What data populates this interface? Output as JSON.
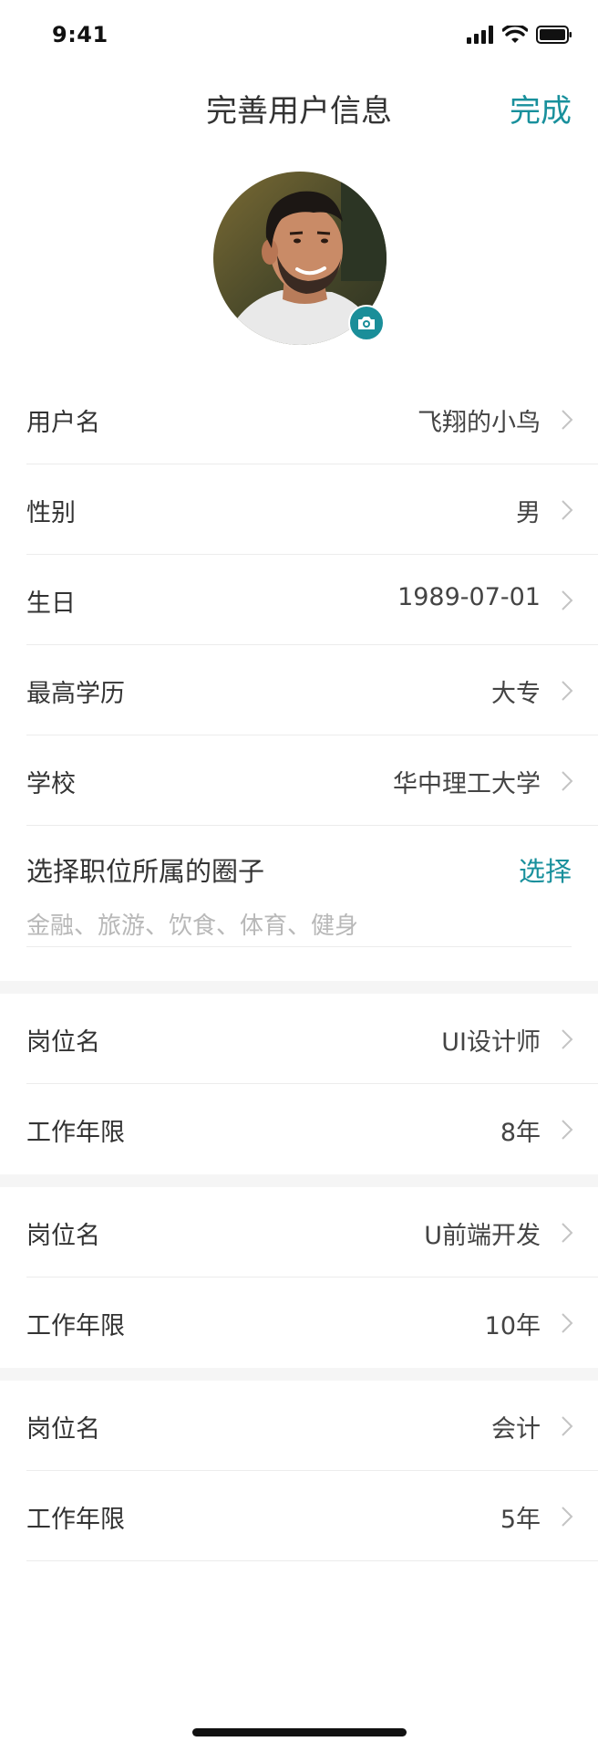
{
  "status_bar": {
    "time": "9:41"
  },
  "nav": {
    "title": "完善用户信息",
    "done_label": "完成"
  },
  "profile": {
    "rows": [
      {
        "label": "用户名",
        "value": "飞翔的小鸟"
      },
      {
        "label": "性别",
        "value": "男"
      },
      {
        "label": "生日",
        "value": "1989-07-01"
      },
      {
        "label": "最高学历",
        "value": "大专"
      },
      {
        "label": "学校",
        "value": "华中理工大学"
      }
    ]
  },
  "circle": {
    "title": "选择职位所属的圈子",
    "select_label": "选择",
    "hint": "金融、旅游、饮食、体育、健身"
  },
  "jobs": [
    {
      "position_label": "岗位名",
      "position_value": "UI设计师",
      "years_label": "工作年限",
      "years_value": "8年"
    },
    {
      "position_label": "岗位名",
      "position_value": "U前端开发",
      "years_label": "工作年限",
      "years_value": "10年"
    },
    {
      "position_label": "岗位名",
      "position_value": "会计",
      "years_label": "工作年限",
      "years_value": "5年"
    }
  ],
  "colors": {
    "accent": "#18909c",
    "text": "#333333",
    "hint": "#b8b8b8",
    "divider": "#ececec",
    "section_gap": "#f5f5f5"
  },
  "icons": {
    "status": [
      "signal-icon",
      "wifi-icon",
      "battery-icon"
    ],
    "avatar_badge": "camera-icon",
    "row_arrow": "chevron-right-icon"
  }
}
